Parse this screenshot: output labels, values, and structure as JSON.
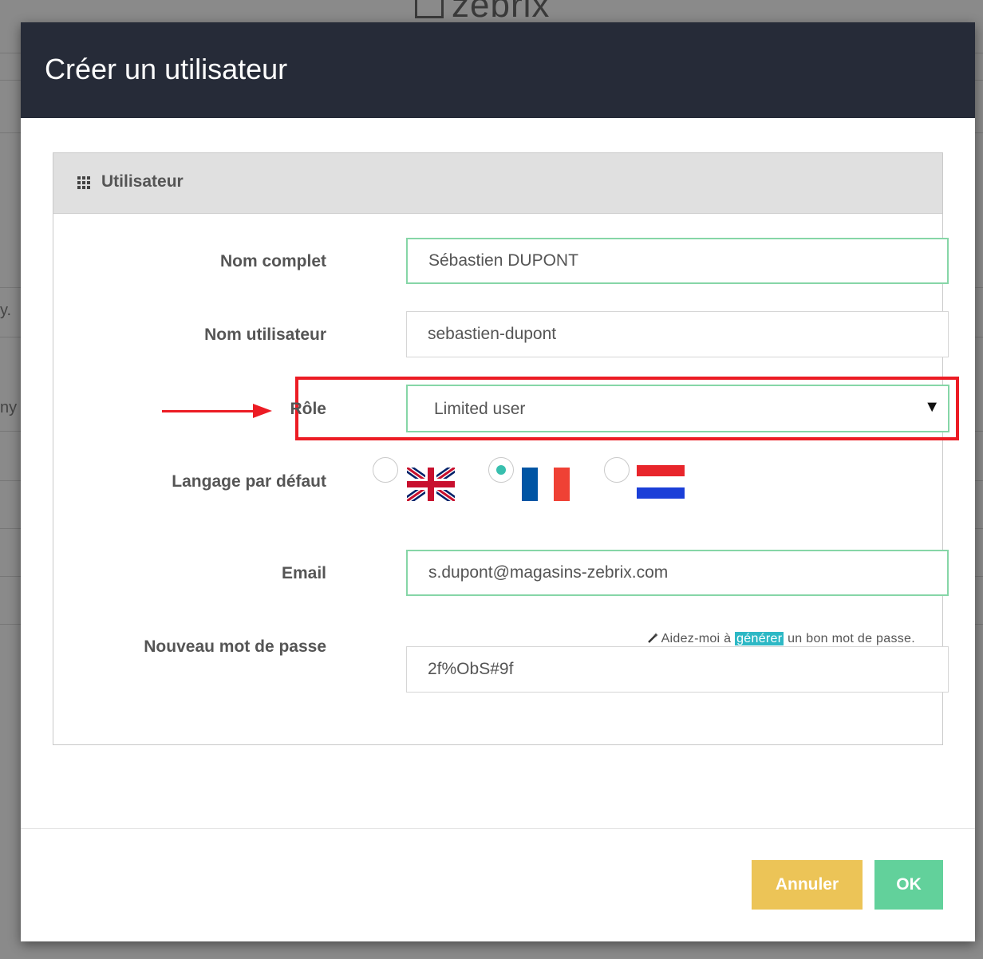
{
  "background": {
    "logo_text": "zebrix",
    "side_fragments": [
      "y.",
      "ny"
    ]
  },
  "modal": {
    "title": "Créer un utilisateur"
  },
  "panel": {
    "icon": "grid-icon",
    "title": "Utilisateur"
  },
  "form": {
    "full_name": {
      "label": "Nom complet",
      "value": "Sébastien DUPONT"
    },
    "username": {
      "label": "Nom utilisateur",
      "value": "sebastien-dupont"
    },
    "role": {
      "label": "Rôle",
      "value": "Limited user"
    },
    "language": {
      "label": "Langage par défaut",
      "options": [
        {
          "flag": "uk-flag",
          "selected": false
        },
        {
          "flag": "france-flag",
          "selected": true
        },
        {
          "flag": "netherlands-flag",
          "selected": false
        }
      ]
    },
    "email": {
      "label": "Email",
      "value": "s.dupont@magasins-zebrix.com"
    },
    "password": {
      "label": "Nouveau mot de passe",
      "value": "2f%ObS#9f",
      "help_before": "Aidez-moi à ",
      "help_link": "générer",
      "help_after": " un bon mot de passe."
    }
  },
  "buttons": {
    "cancel": "Annuler",
    "ok": "OK"
  },
  "colors": {
    "header_bg": "#262b38",
    "input_valid_border": "#86d6a7",
    "highlight_red": "#ec1c24",
    "cancel_bg": "#ecc457",
    "ok_bg": "#62d19b",
    "link_bg": "#2db8c5"
  }
}
